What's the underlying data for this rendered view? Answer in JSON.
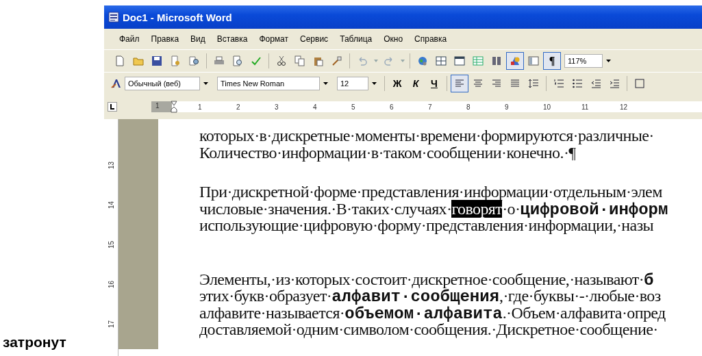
{
  "caption": "затронут",
  "window": {
    "title": "Doc1 - Microsoft Word"
  },
  "menu": [
    "Файл",
    "Правка",
    "Вид",
    "Вставка",
    "Формат",
    "Сервис",
    "Таблица",
    "Окно",
    "Справка"
  ],
  "standard_toolbar": {
    "buttons": [
      {
        "pressed": false
      },
      {
        "pressed": false
      },
      {
        "pressed": false
      },
      {
        "pressed": false
      },
      {
        "pressed": false
      },
      {
        "pressed": false
      },
      {
        "pressed": false
      },
      {
        "pressed": false
      },
      {
        "pressed": false
      },
      {
        "pressed": false
      },
      {
        "pressed": false
      },
      {
        "pressed": false
      },
      {
        "pressed": false
      },
      {
        "pressed": false
      },
      {
        "pressed": false
      },
      {
        "pressed": false
      },
      {
        "pressed": false
      },
      {
        "pressed": false
      },
      {
        "pressed": false
      },
      {
        "pressed": false
      },
      {
        "pressed": false
      },
      {
        "pressed": true
      },
      {
        "pressed": false
      },
      {
        "pressed": true,
        "label": "¶"
      }
    ],
    "zoom": "117%"
  },
  "formatting_toolbar": {
    "style": "Обычный (веб)",
    "font": "Times New Roman",
    "size": "12",
    "buttons": [
      {
        "label": "Ж",
        "pressed": false
      },
      {
        "label": "К",
        "pressed": false
      },
      {
        "label": "Ч",
        "pressed": false
      },
      {
        "pressed": true
      },
      {
        "pressed": false
      },
      {
        "pressed": false
      },
      {
        "pressed": false
      },
      {
        "pressed": false
      },
      {
        "pressed": false
      },
      {
        "pressed": false
      },
      {
        "pressed": false
      },
      {
        "pressed": false
      },
      {
        "pressed": false
      }
    ]
  },
  "ruler": {
    "numbers": [
      "1",
      "1",
      "2",
      "3",
      "4",
      "5",
      "6",
      "7",
      "8",
      "9",
      "10",
      "11",
      "12"
    ]
  },
  "vertical_ruler": {
    "numbers": [
      "13",
      "14",
      "15",
      "16",
      "17"
    ]
  },
  "paragraphs": [
    {
      "lines": [
        [
          {
            "text": "которых·в·дискретные·моменты·времени·формируются·различные·",
            "selected": false
          }
        ],
        [
          {
            "text": "Количество·информации·в·таком·сообщении·конечно.·¶",
            "selected": false
          }
        ]
      ]
    },
    {
      "lines": [
        [
          {
            "text": "При·дискретной·форме·представления·информации·отдельным·элем",
            "selected": false
          }
        ],
        [
          {
            "text": "числовые·значения.·В·таких·случаях·",
            "selected": false
          },
          {
            "text": "говорят",
            "selected": true
          },
          {
            "text": "·о·**цифровой·информ**",
            "selected": false
          }
        ],
        [
          {
            "text": "использующие·цифровую·форму·представления·информации,·назы",
            "selected": false
          }
        ]
      ]
    },
    {
      "lines": [
        [
          {
            "text": "Элементы,·из·которых·состоит·дискретное·сообщение,·называют·**б**",
            "selected": false
          }
        ],
        [
          {
            "text": "этих·букв·образует·**алфавит·сообщения**,·где·буквы·-·любые·воз",
            "selected": false
          }
        ],
        [
          {
            "text": "алфавите·называется·**объемом·алфавита**.·Объем·алфавита·опред",
            "selected": false
          }
        ],
        [
          {
            "text": "доставляемой·одним·символом·сообщения.·Дискретное·сообщение·",
            "selected": false
          }
        ]
      ]
    }
  ]
}
